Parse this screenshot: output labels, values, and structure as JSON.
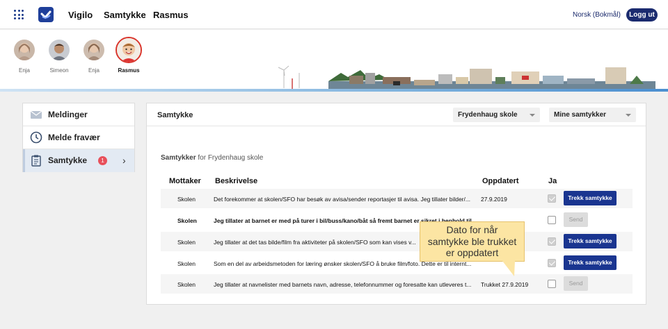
{
  "topbar": {
    "nav": [
      "Vigilo",
      "Samtykke",
      "Rasmus"
    ],
    "language": "Norsk (Bokmål)",
    "logout_label": "Logg ut"
  },
  "children": [
    {
      "name": "Enja",
      "active": false
    },
    {
      "name": "Simeon",
      "active": false
    },
    {
      "name": "Enja",
      "active": false
    },
    {
      "name": "Rasmus",
      "active": true
    }
  ],
  "sidebar": {
    "items": [
      {
        "label": "Meldinger",
        "icon": "envelope-icon"
      },
      {
        "label": "Melde fravær",
        "icon": "clock-icon"
      },
      {
        "label": "Samtykke",
        "icon": "clipboard-icon",
        "badge": "1"
      }
    ]
  },
  "panel": {
    "title": "Samtykke",
    "school_select": "Frydenhaug skole",
    "filter_select": "Mine samtykker",
    "subtitle_bold": "Samtykker",
    "subtitle_rest": " for Frydenhaug skole",
    "headers": {
      "mottaker": "Mottaker",
      "beskrivelse": "Beskrivelse",
      "oppdatert": "Oppdatert",
      "ja": "Ja"
    },
    "rows": [
      {
        "mottaker": "Skolen",
        "beskrivelse": "Det forekommer at skolen/SFO har besøk av avisa/sender reportasjer til avisa. Jeg tillater bilder/...",
        "oppdatert": "27.9.2019",
        "checked": true,
        "button": "Trekk samtykke"
      },
      {
        "mottaker": "Skolen",
        "beskrivelse": "Jeg tillater at barnet er med på turer i bil/buss/kano/båt så fremt barnet er sikret i henhold til gj...",
        "oppdatert": "",
        "checked": false,
        "button": "Send"
      },
      {
        "mottaker": "Skolen",
        "beskrivelse": "Jeg tillater at det tas bilde/film fra aktiviteter på skolen/SFO som kan vises v...",
        "oppdatert": "",
        "checked": true,
        "button": "Trekk samtykke"
      },
      {
        "mottaker": "Skolen",
        "beskrivelse": "Som en del av arbeidsmetoden for læring ønsker skolen/SFO å bruke film/foto. Dette er til internt...",
        "oppdatert": "",
        "checked": true,
        "button": "Trekk samtykke"
      },
      {
        "mottaker": "Skolen",
        "beskrivelse": "Jeg tillater at navnelister med barnets navn, adresse, telefonnummer og foresatte kan utleveres t...",
        "oppdatert": "Trukket 27.9.2019",
        "checked": false,
        "button": "Send"
      }
    ]
  },
  "tooltip": {
    "line1": "Dato for når",
    "line2": "samtykke ble trukket",
    "line3": "er oppdatert"
  },
  "colors": {
    "brand": "#1a3590",
    "badge": "#e8505b",
    "tooltip": "#fce5a3"
  }
}
